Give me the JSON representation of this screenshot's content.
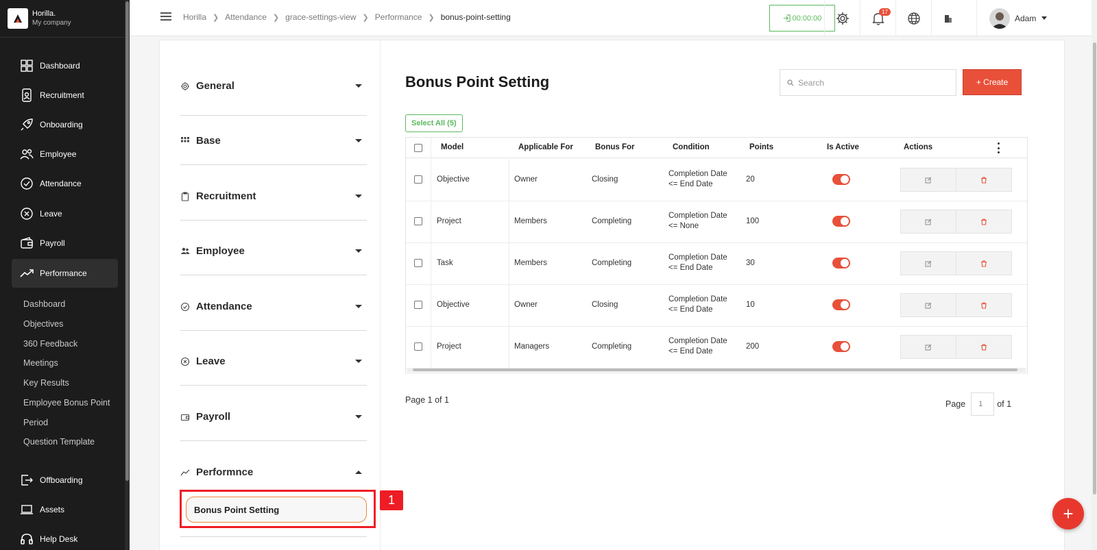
{
  "brand": {
    "name": "Horilla.",
    "company": "My company"
  },
  "sidebar": {
    "items": [
      {
        "label": "Dashboard",
        "icon": "dashboard-icon"
      },
      {
        "label": "Recruitment",
        "icon": "recruitment-icon"
      },
      {
        "label": "Onboarding",
        "icon": "rocket-icon"
      },
      {
        "label": "Employee",
        "icon": "people-icon"
      },
      {
        "label": "Attendance",
        "icon": "check-circle-icon"
      },
      {
        "label": "Leave",
        "icon": "x-circle-icon"
      },
      {
        "label": "Payroll",
        "icon": "wallet-icon"
      },
      {
        "label": "Performance",
        "icon": "trend-icon"
      },
      {
        "label": "Offboarding",
        "icon": "exit-icon"
      },
      {
        "label": "Assets",
        "icon": "laptop-icon"
      },
      {
        "label": "Help Desk",
        "icon": "headset-icon"
      }
    ],
    "performance_sub": [
      "Dashboard",
      "Objectives",
      "360 Feedback",
      "Meetings",
      "Key Results",
      "Employee Bonus Point",
      "Period",
      "Question Template"
    ]
  },
  "header": {
    "breadcrumb": [
      "Horilla",
      "Attendance",
      "grace-settings-view",
      "Performance",
      "bonus-point-setting"
    ],
    "timer": "00:00:00",
    "notifications_count": "17",
    "user_name": "Adam"
  },
  "settings_menu": {
    "sections": [
      {
        "title": "General",
        "icon": "gear-icon"
      },
      {
        "title": "Base",
        "icon": "grid-icon"
      },
      {
        "title": "Recruitment",
        "icon": "clipboard-icon"
      },
      {
        "title": "Employee",
        "icon": "people-icon"
      },
      {
        "title": "Attendance",
        "icon": "check-circle-icon"
      },
      {
        "title": "Leave",
        "icon": "x-circle-icon"
      },
      {
        "title": "Payroll",
        "icon": "wallet-icon"
      },
      {
        "title": "Performnce",
        "icon": "trend-icon"
      }
    ],
    "active_sub": "Bonus Point Setting",
    "highlight_number": "1"
  },
  "main": {
    "title": "Bonus Point Setting",
    "search_placeholder": "Search",
    "create_label": "+ Create",
    "select_all_label": "Select All (5)",
    "columns": [
      "Model",
      "Applicable For",
      "Bonus For",
      "Condition",
      "Points",
      "Is Active",
      "Actions"
    ],
    "rows": [
      {
        "model": "Objective",
        "applicable_for": "Owner",
        "bonus_for": "Closing",
        "condition_1": "Completion Date",
        "condition_2": "<= End Date",
        "points": "20"
      },
      {
        "model": "Project",
        "applicable_for": "Members",
        "bonus_for": "Completing",
        "condition_1": "Completion Date",
        "condition_2": "<= None",
        "points": "100"
      },
      {
        "model": "Task",
        "applicable_for": "Members",
        "bonus_for": "Completing",
        "condition_1": "Completion Date",
        "condition_2": "<= End Date",
        "points": "30"
      },
      {
        "model": "Objective",
        "applicable_for": "Owner",
        "bonus_for": "Closing",
        "condition_1": "Completion Date",
        "condition_2": "<= End Date",
        "points": "10"
      },
      {
        "model": "Project",
        "applicable_for": "Managers",
        "bonus_for": "Completing",
        "condition_1": "Completion Date",
        "condition_2": "<= End Date",
        "points": "200"
      }
    ],
    "pager_left": "Page 1 of 1",
    "pager_label": "Page",
    "pager_value": "1",
    "pager_of": "of 1"
  },
  "fab_label": "+",
  "colors": {
    "accent": "#e8503a",
    "success": "#5bb85d",
    "sidebar": "#1c1c1c",
    "highlight": "#ee1c24"
  }
}
